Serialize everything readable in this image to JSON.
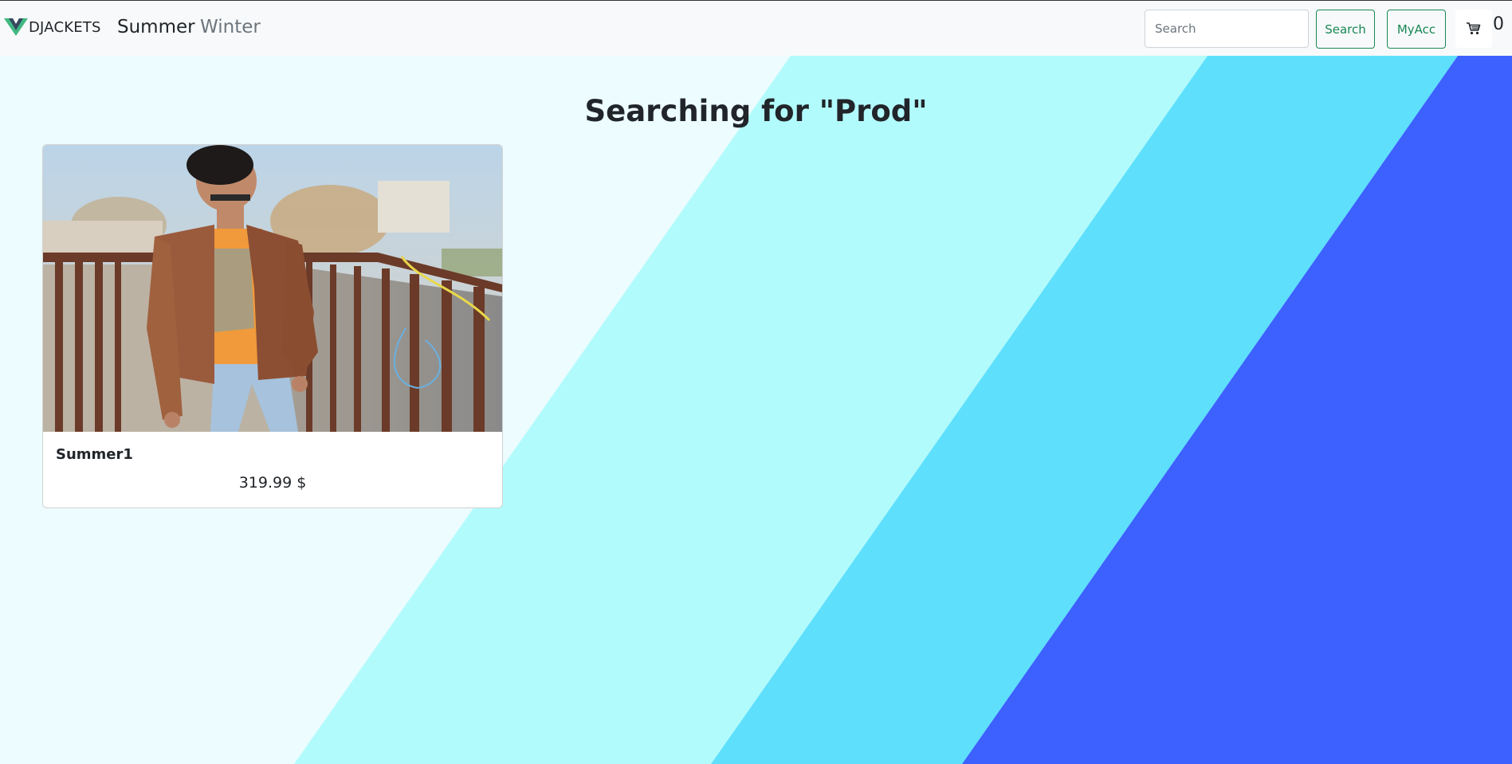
{
  "brand": {
    "text": "DJACKETS",
    "logo_icon": "vue-logo-icon"
  },
  "nav": [
    {
      "label": "Summer",
      "active": true
    },
    {
      "label": "Winter",
      "active": false
    }
  ],
  "search": {
    "placeholder": "Search",
    "value": "",
    "button_label": "Search"
  },
  "account": {
    "label": "MyAcc"
  },
  "cart": {
    "icon": "cart-icon",
    "count": "0"
  },
  "page": {
    "title": "Searching for \"Prod\""
  },
  "products": [
    {
      "name": "Summer1",
      "price": "319.99 $",
      "image_icon": "product-photo"
    }
  ],
  "colors": {
    "page_bg": "#ecfcff",
    "stripe_light": "#b2fbfd",
    "stripe_mid": "#5ee0fd",
    "stripe_dark": "#3d61fe",
    "accent": "#198754",
    "navbar_bg": "#f8f9fa"
  }
}
